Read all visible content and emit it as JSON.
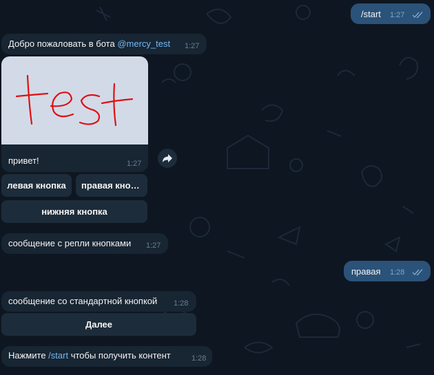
{
  "messages": {
    "start_cmd": {
      "text": "/start",
      "time": "1:27"
    },
    "welcome": {
      "text": "Добро пожаловать в бота ",
      "mention": "@mercy_test",
      "time": "1:27"
    },
    "photo_caption": {
      "text": "привет!",
      "time": "1:27"
    },
    "reply_buttons_msg": {
      "text": "сообщение с репли кнопками",
      "time": "1:27"
    },
    "right_reply": {
      "text": "правая",
      "time": "1:28"
    },
    "standard_button_msg": {
      "text": "сообщение со стандартной кнопкой",
      "time": "1:28"
    },
    "press_start": {
      "prefix": "Нажмите ",
      "command": "/start",
      "suffix": " чтобы получить контент",
      "time": "1:28"
    }
  },
  "inline_keyboard": {
    "left": "левая кнопка",
    "right": "правая кнопка",
    "bottom": "нижняя кнопка"
  },
  "standard_keyboard": {
    "next": "Далее"
  },
  "image_text": "test",
  "colors": {
    "background": "#0e1621",
    "incoming_bubble": "#182533",
    "outgoing_bubble": "#2b5278",
    "link": "#71baf5",
    "drawing": "#e01010"
  },
  "icons": {
    "read_status": "double-check-icon",
    "forward": "share-arrow-icon"
  }
}
